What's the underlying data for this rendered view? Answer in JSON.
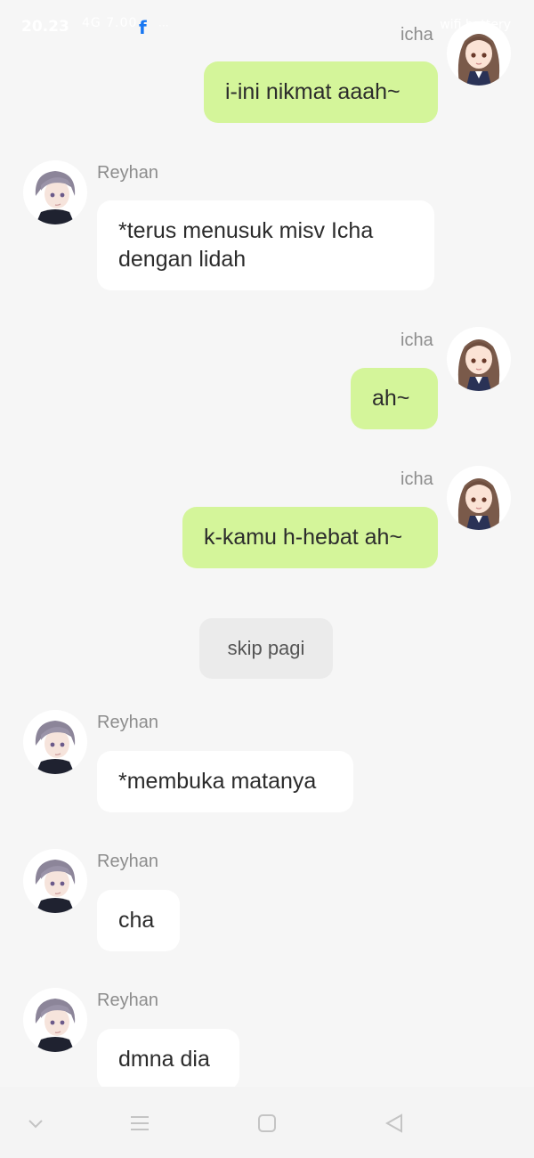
{
  "status_bar": {
    "time": "20.23",
    "signal": "4G 7.00",
    "app_icon": "facebook-icon",
    "right_icons": "wifi battery"
  },
  "messages": [
    {
      "side": "right",
      "sender": "icha",
      "text": "i-ini nikmat aaah~"
    },
    {
      "side": "left",
      "sender": "Reyhan",
      "text": "*terus menusuk misv Icha dengan lidah"
    },
    {
      "side": "right",
      "sender": "icha",
      "text": "ah~"
    },
    {
      "side": "right",
      "sender": "icha",
      "text": "k-kamu h-hebat ah~"
    },
    {
      "side": "left",
      "sender": "Reyhan",
      "text": "*membuka matanya"
    },
    {
      "side": "left",
      "sender": "Reyhan",
      "text": "cha"
    },
    {
      "side": "left",
      "sender": "Reyhan",
      "text": "dmna dia"
    }
  ],
  "system_button": {
    "label": "skip pagi"
  },
  "navbar": {
    "icons": [
      "chevron-down-icon",
      "menu-icon",
      "home-square-icon",
      "back-triangle-icon"
    ]
  },
  "colors": {
    "right_bubble": "#d4f59a",
    "left_bubble": "#ffffff",
    "background": "#f6f6f6",
    "sender_text": "#8d8d8d"
  }
}
